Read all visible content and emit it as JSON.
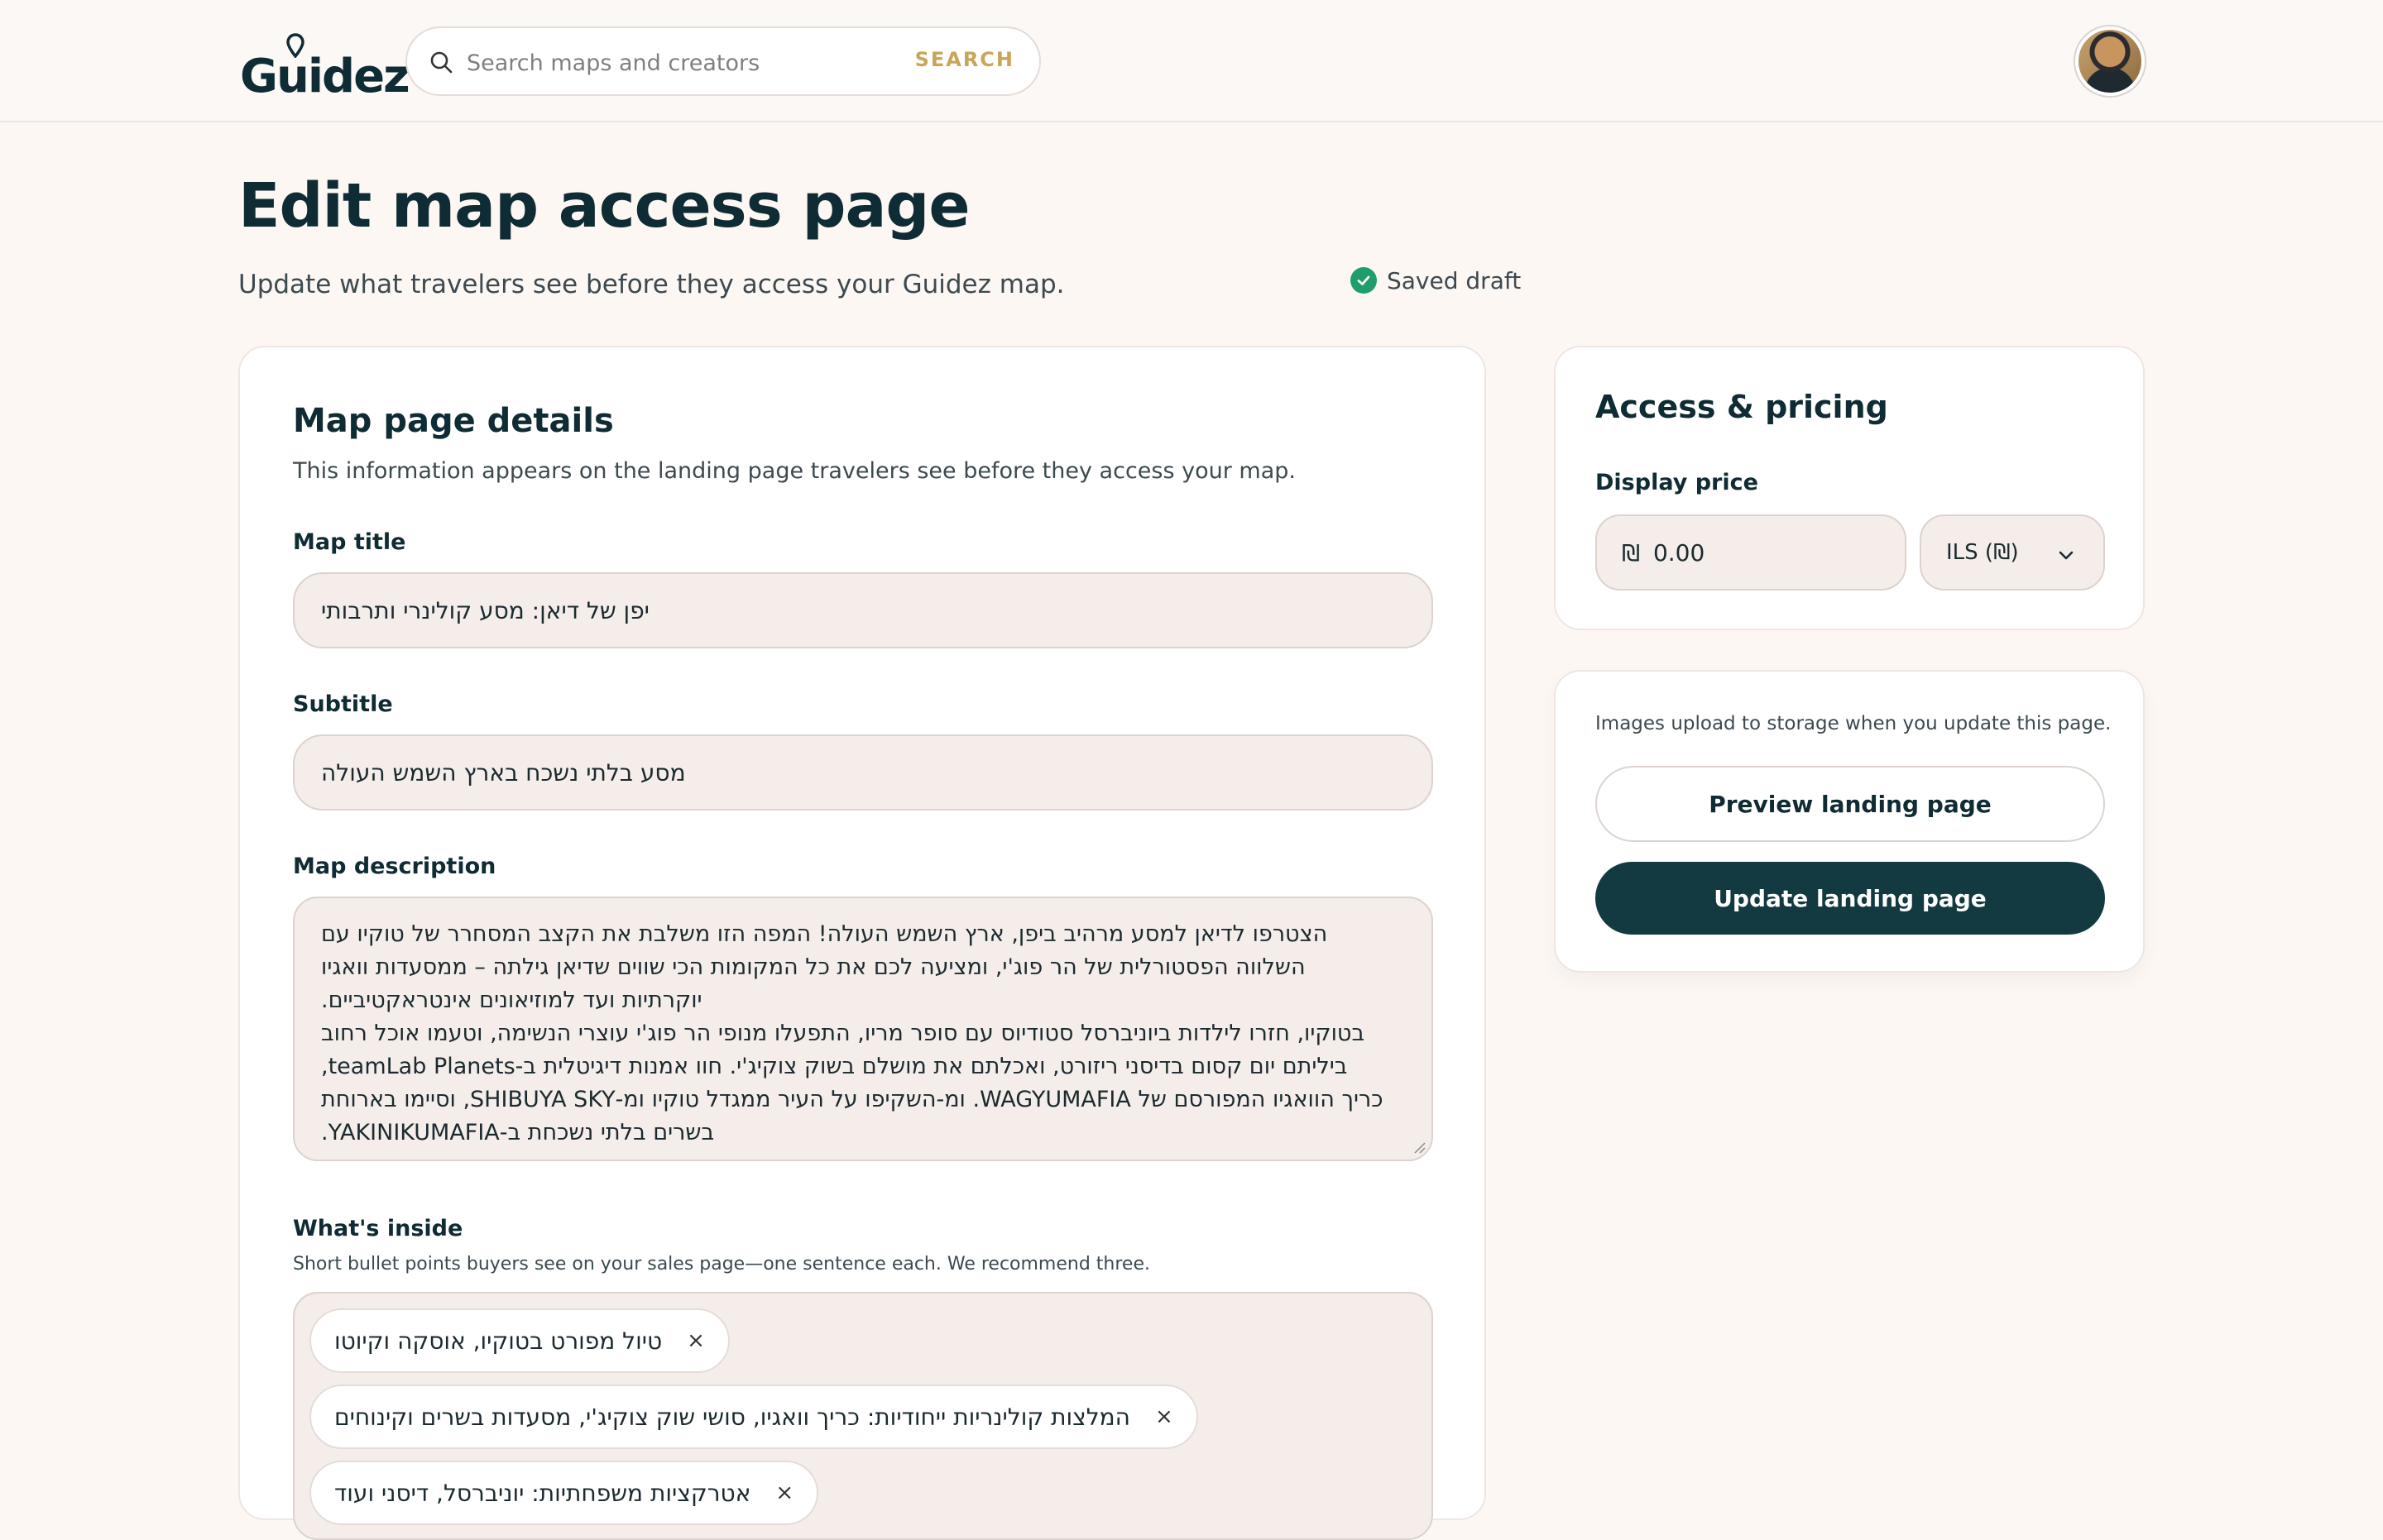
{
  "header": {
    "logo_text": "Guidez",
    "search_placeholder": "Search maps and creators",
    "search_button": "SEARCH",
    "avatar_icon": "user-avatar"
  },
  "page": {
    "title": "Edit map access page",
    "subtitle": "Update what travelers see before they access your Guidez map.",
    "status": "Saved draft",
    "status_color": "#1f9d6a"
  },
  "details": {
    "title": "Map page details",
    "description": "This information appears on the landing page travelers see before they access your map.",
    "map_title_label": "Map title",
    "map_title_value": "יפן של דיאן: מסע קולינרי ותרבותי",
    "subtitle_label": "Subtitle",
    "subtitle_value": "מסע בלתי נשכח בארץ השמש העולה",
    "description_label": "Map description",
    "description_lines": [
      "הצטרפו לדיאן למסע מרהיב ביפן, ארץ השמש העולה! המפה הזו משלבת את הקצב המסחרר של טוקיו עם",
      "השלווה הפסטורלית של הר פוג'י, ומציעה לכם את כל המקומות הכי שווים שדיאן גילתה – ממסעדות וואגיו",
      "יוקרתיות ועד למוזיאונים אינטראקטיביים.",
      "בטוקיו, חזרו לילדות ביוניברסל סטודיוס עם סופר מריו, התפעלו מנופי הר פוג'י עוצרי הנשימה, וטעמו אוכל רחוב",
      "ביליתם יום קסום בדיסני ריזורט, ואכלתם את מושלם בשוק צוקיג'י. חוו אמנות דיגיטלית ב-teamLab Planets,",
      "כריך הוואגיו המפורסם של WAGYUMAFIA. ומ-השקיפו על העיר ממגדל טוקיו ומ-SHIBUYA SKY, וסיימו בארוחת",
      "בשרים בלתי נשכחת ב-YAKINIKUMAFIA."
    ],
    "inside_label": "What's inside",
    "inside_description": "Short bullet points buyers see on your sales page—one sentence each. We recommend three.",
    "inside_items": [
      "טיול מפורט בטוקיו, אוסקה וקיוטו",
      "המלצות קולינריות ייחודיות: כריך וואגיו, סושי שוק צוקיג'י, מסעדות בשרים וקינוחים",
      "אטרקציות משפחתיות: יוניברסל, דיסני ועוד"
    ],
    "remove_glyph": "×"
  },
  "pricing": {
    "title": "Access & pricing",
    "price_label": "Display price",
    "currency_symbol": "₪",
    "price_value": "0.00",
    "currency_selected": "ILS (₪)"
  },
  "actions": {
    "note": "Images upload to storage when you update this page.",
    "preview_button": "Preview landing page",
    "update_button": "Update landing page",
    "primary_color": "#123a40"
  }
}
